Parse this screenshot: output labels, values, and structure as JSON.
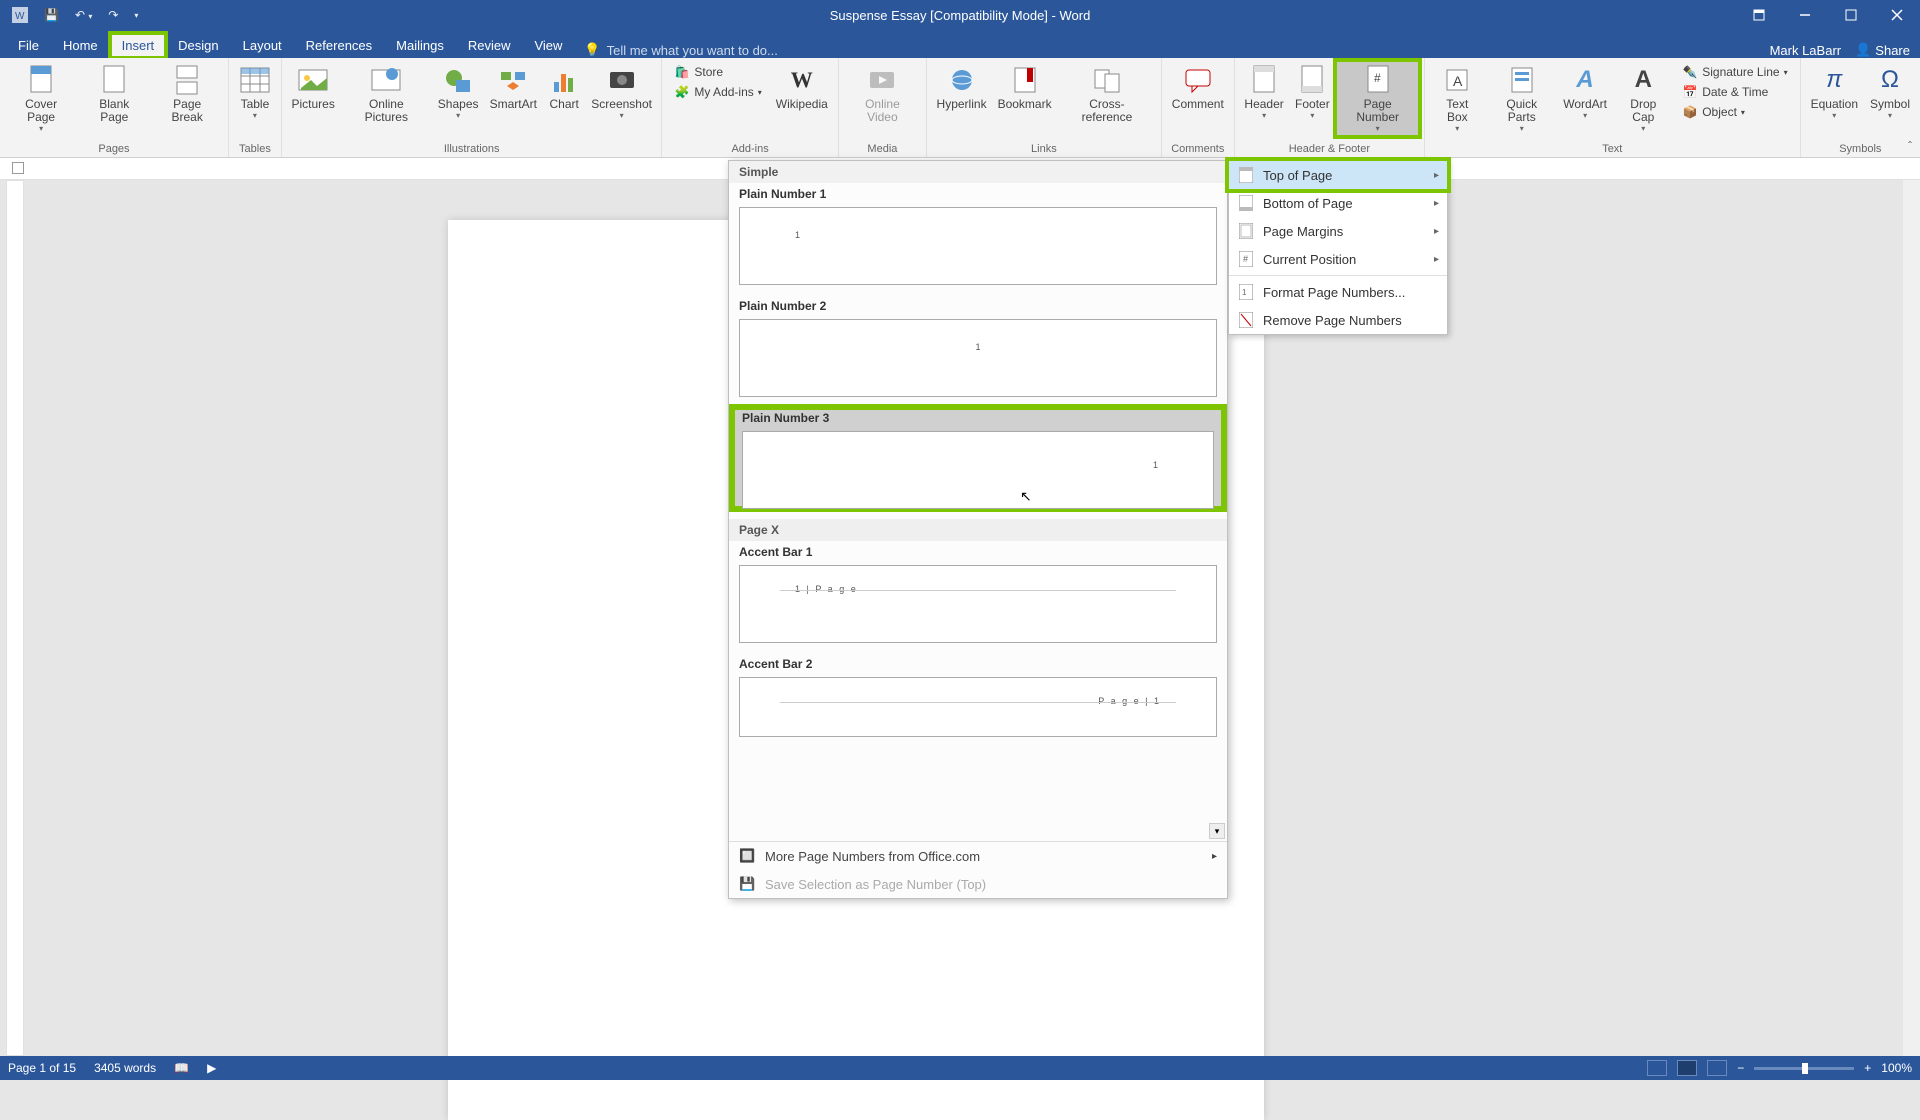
{
  "title": "Suspense Essay [Compatibility Mode] - Word",
  "user": "Mark LaBarr",
  "share": "Share",
  "tellme": "Tell me what you want to do...",
  "tabs": {
    "file": "File",
    "home": "Home",
    "insert": "Insert",
    "design": "Design",
    "layout": "Layout",
    "references": "References",
    "mailings": "Mailings",
    "review": "Review",
    "view": "View"
  },
  "ribbon": {
    "pages": {
      "cover": "Cover\nPage",
      "blank": "Blank\nPage",
      "break": "Page\nBreak",
      "label": "Pages"
    },
    "tables": {
      "table": "Table",
      "label": "Tables"
    },
    "illus": {
      "pictures": "Pictures",
      "online": "Online\nPictures",
      "shapes": "Shapes",
      "smartart": "SmartArt",
      "chart": "Chart",
      "screenshot": "Screenshot",
      "label": "Illustrations"
    },
    "addins": {
      "store": "Store",
      "myaddins": "My Add-ins",
      "wikipedia": "Wikipedia",
      "label": "Add-ins"
    },
    "media": {
      "video": "Online\nVideo"
    },
    "links": {
      "hyperlink": "Hyperlink",
      "bookmark": "Bookmark",
      "crossref": "Cross-\nreference"
    },
    "comments": {
      "comment": "Comment"
    },
    "headerfooter": {
      "header": "Header",
      "footer": "Footer",
      "pagenum": "Page\nNumber"
    },
    "text": {
      "textbox": "Text\nBox",
      "quickparts": "Quick\nParts",
      "wordart": "WordArt",
      "dropcap": "Drop\nCap",
      "sig": "Signature Line",
      "date": "Date & Time",
      "object": "Object",
      "label": "Text"
    },
    "symbols": {
      "equation": "Equation",
      "symbol": "Symbol",
      "label": "Symbols"
    }
  },
  "pn_menu": {
    "top": "Top of Page",
    "bottom": "Bottom of Page",
    "margins": "Page Margins",
    "current": "Current Position",
    "format": "Format Page Numbers...",
    "remove": "Remove Page Numbers"
  },
  "gallery": {
    "section1": "Simple",
    "item1": "Plain Number 1",
    "item2": "Plain Number 2",
    "item3": "Plain Number 3",
    "section2": "Page X",
    "item4": "Accent Bar 1",
    "item4_preview": "1 | P a g e",
    "item5": "Accent Bar 2",
    "item5_preview": "P a g e  | 1",
    "more": "More Page Numbers from Office.com",
    "save": "Save Selection as Page Number (Top)"
  },
  "status": {
    "page": "Page 1 of 15",
    "words": "3405 words",
    "zoom": "100%"
  }
}
